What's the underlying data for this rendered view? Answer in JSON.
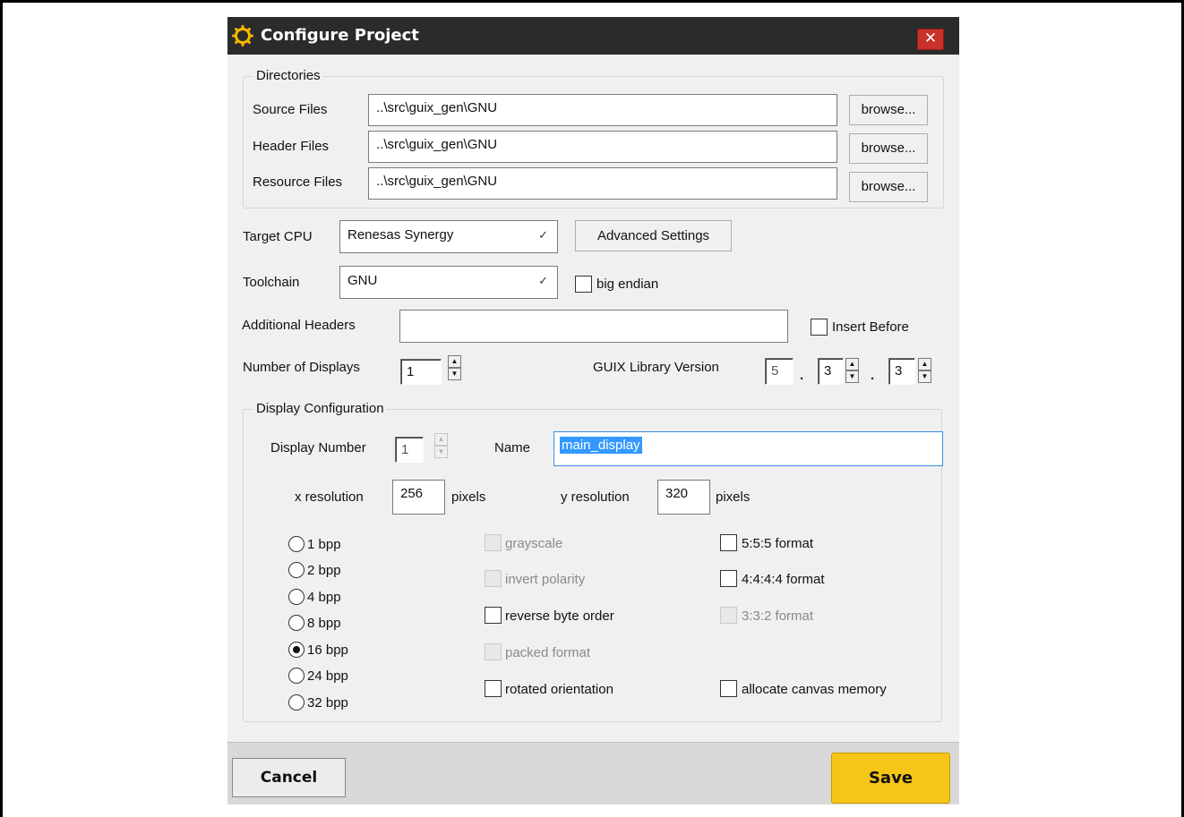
{
  "dialog": {
    "title": "Configure Project",
    "close_icon": "close-icon",
    "title_icon": "gear-icon"
  },
  "directories": {
    "group_label": "Directories",
    "rows": [
      {
        "label": "Source Files",
        "value": "..\\src\\guix_gen\\GNU",
        "button": "browse..."
      },
      {
        "label": "Header Files",
        "value": "..\\src\\guix_gen\\GNU",
        "button": "browse..."
      },
      {
        "label": "Resource Files",
        "value": "..\\src\\guix_gen\\GNU",
        "button": "browse..."
      }
    ]
  },
  "target_cpu": {
    "label": "Target CPU",
    "value": "Renesas Synergy",
    "advanced_button": "Advanced Settings"
  },
  "toolchain": {
    "label": "Toolchain",
    "value": "GNU",
    "big_endian_label": "big endian",
    "big_endian_checked": false
  },
  "additional_headers": {
    "label": "Additional Headers",
    "value": "",
    "insert_before_label": "Insert Before",
    "insert_before_checked": false
  },
  "displays": {
    "label": "Number of Displays",
    "value": "1"
  },
  "guix_version": {
    "label": "GUIX Library Version",
    "major": "5",
    "minor": "3",
    "patch": "3",
    "sep": "."
  },
  "display_config": {
    "group_label": "Display Configuration",
    "display_number_label": "Display Number",
    "display_number": "1",
    "name_label": "Name",
    "name_value": "main_display",
    "x_res_label": "x resolution",
    "x_res_value": "256",
    "y_res_label": "y resolution",
    "y_res_value": "320",
    "pixels_label": "pixels",
    "bpp_options": [
      "1 bpp",
      "2 bpp",
      "4 bpp",
      "8 bpp",
      "16 bpp",
      "24 bpp",
      "32 bpp"
    ],
    "bpp_selected": "16 bpp",
    "options_col1": [
      {
        "label": "grayscale",
        "enabled": false,
        "checked": false
      },
      {
        "label": "invert polarity",
        "enabled": false,
        "checked": false
      },
      {
        "label": "reverse byte order",
        "enabled": true,
        "checked": false
      },
      {
        "label": "packed format",
        "enabled": false,
        "checked": false
      },
      {
        "label": "rotated orientation",
        "enabled": true,
        "checked": false
      }
    ],
    "options_col2": [
      {
        "label": "5:5:5 format",
        "enabled": true,
        "checked": false
      },
      {
        "label": "4:4:4:4 format",
        "enabled": true,
        "checked": false
      },
      {
        "label": "3:3:2 format",
        "enabled": false,
        "checked": false
      },
      {
        "label": "allocate canvas memory",
        "enabled": true,
        "checked": false
      }
    ]
  },
  "footer": {
    "cancel_label": "Cancel",
    "save_label": "Save",
    "save_color": "#f5c518"
  }
}
